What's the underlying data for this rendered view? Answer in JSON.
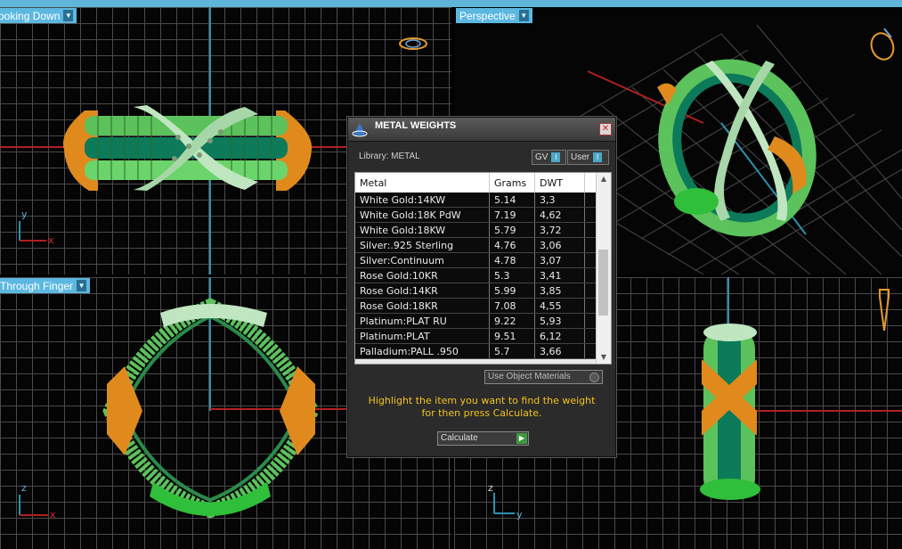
{
  "viewports": {
    "top_left": {
      "label": "ooking Down",
      "axis_v": "y",
      "axis_h": "x"
    },
    "top_right": {
      "label": "Perspective"
    },
    "bottom_left": {
      "label": "Through Finger",
      "axis_v": "z",
      "axis_h": "x"
    },
    "bottom_right": {
      "axis_v": "z",
      "axis_h": "y"
    }
  },
  "dialog": {
    "title": "METAL WEIGHTS",
    "close_glyph": "✕",
    "library_label": "Library: METAL",
    "gv_label": "GV",
    "user_label": "User",
    "columns": [
      "Metal",
      "Grams",
      "DWT"
    ],
    "rows": [
      [
        "White Gold:14KW",
        "5.14",
        "3,3"
      ],
      [
        "White Gold:18K PdW",
        "7.19",
        "4,62"
      ],
      [
        "White Gold:18KW",
        "5.79",
        "3,72"
      ],
      [
        "Silver:.925 Sterling",
        "4.76",
        "3,06"
      ],
      [
        "Silver:Continuum",
        "4.78",
        "3,07"
      ],
      [
        "Rose Gold:10KR",
        "5.3",
        "3,41"
      ],
      [
        "Rose Gold:14KR",
        "5.99",
        "3,85"
      ],
      [
        "Rose Gold:18KR",
        "7.08",
        "4,55"
      ],
      [
        "Platinum:PLAT RU",
        "9.22",
        "5,93"
      ],
      [
        "Platinum:PLAT",
        "9.51",
        "6,12"
      ],
      [
        "Palladium:PALL .950",
        "5.7",
        "3,66"
      ]
    ],
    "use_object_materials_label": "Use Object Materials",
    "message_line1": "Highlight the item you want to find the weight",
    "message_line2": "for then press Calculate.",
    "calculate_label": "Calculate"
  },
  "colors": {
    "viewport_label_bg": "#5cb8e0",
    "message_yellow": "#f3c21d",
    "ring_green": "#4fb04f",
    "ring_dark_green": "#0d7a5a",
    "ring_orange": "#e08a1e",
    "ring_mint": "#bfe6c0"
  }
}
